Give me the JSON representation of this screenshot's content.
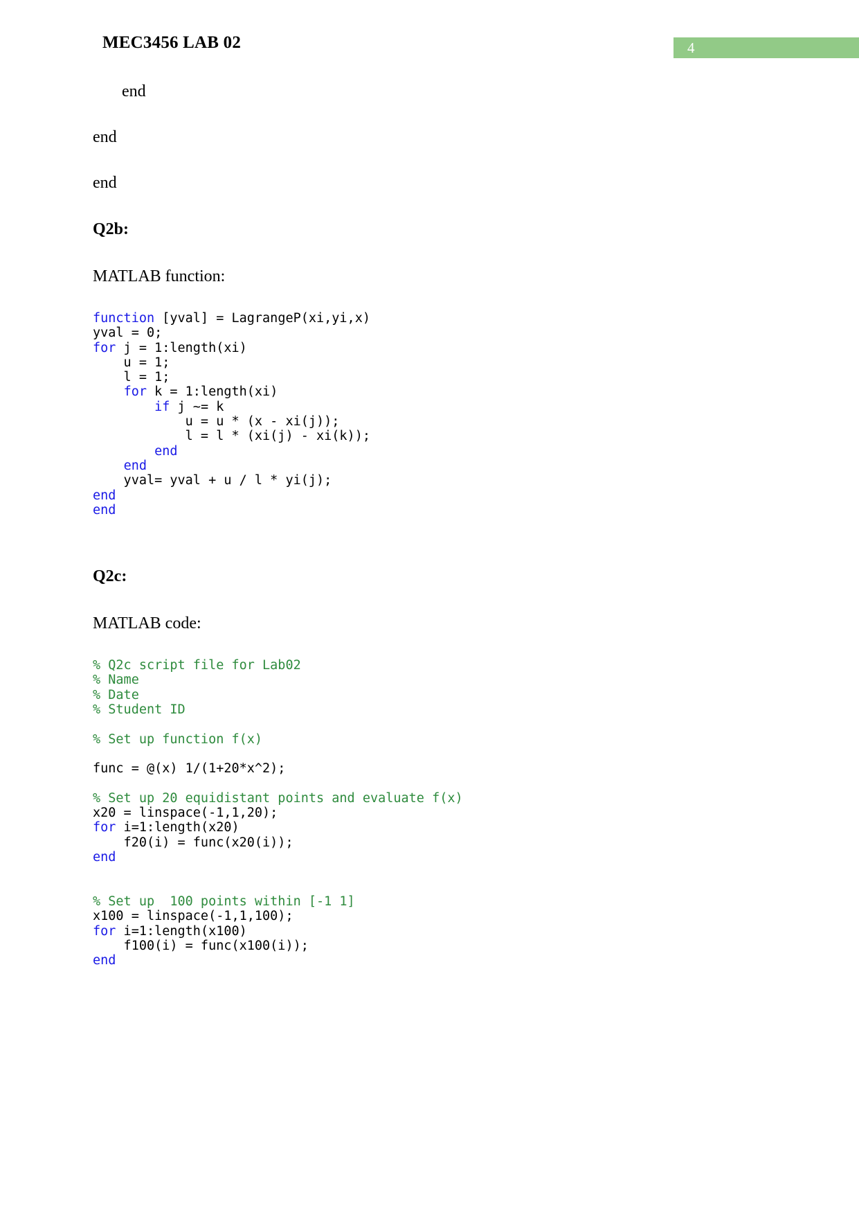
{
  "header": {
    "title": "MEC3456 LAB 02",
    "page_number": "4",
    "badge_color": "#92ca87"
  },
  "content": {
    "end_indented": "   end",
    "end_1": "end",
    "end_2": "end",
    "q2b_heading": "Q2b:",
    "matlab_function_label": "MATLAB function:",
    "q2c_heading": "Q2c:",
    "matlab_code_label": "MATLAB code:"
  },
  "code_function": {
    "lines": [
      [
        {
          "t": "function",
          "c": "kw"
        },
        {
          "t": " [yval] = LagrangeP(xi,yi,x)",
          "c": ""
        }
      ],
      [
        {
          "t": "yval = 0;",
          "c": ""
        }
      ],
      [
        {
          "t": "for",
          "c": "kw"
        },
        {
          "t": " j = 1:length(xi)",
          "c": ""
        }
      ],
      [
        {
          "t": "    u = 1;",
          "c": ""
        }
      ],
      [
        {
          "t": "    l = 1;",
          "c": ""
        }
      ],
      [
        {
          "t": "    ",
          "c": ""
        },
        {
          "t": "for",
          "c": "kw"
        },
        {
          "t": " k = 1:length(xi)",
          "c": ""
        }
      ],
      [
        {
          "t": "        ",
          "c": ""
        },
        {
          "t": "if",
          "c": "kw"
        },
        {
          "t": " j ~= k",
          "c": ""
        }
      ],
      [
        {
          "t": "            u = u * (x - xi(j));",
          "c": ""
        }
      ],
      [
        {
          "t": "            l = l * (xi(j) - xi(k));",
          "c": ""
        }
      ],
      [
        {
          "t": "        ",
          "c": ""
        },
        {
          "t": "end",
          "c": "kw"
        }
      ],
      [
        {
          "t": "    ",
          "c": ""
        },
        {
          "t": "end",
          "c": "kw"
        }
      ],
      [
        {
          "t": "    yval= yval + u / l * yi(j);",
          "c": ""
        }
      ],
      [
        {
          "t": "end",
          "c": "kw"
        }
      ],
      [
        {
          "t": "end",
          "c": "kw"
        }
      ]
    ]
  },
  "code_script": {
    "lines": [
      [
        {
          "t": "% Q2c script file for Lab02",
          "c": "cmt"
        }
      ],
      [
        {
          "t": "% Name",
          "c": "cmt"
        }
      ],
      [
        {
          "t": "% Date",
          "c": "cmt"
        }
      ],
      [
        {
          "t": "% Student ID",
          "c": "cmt"
        }
      ],
      [
        {
          "t": "",
          "c": ""
        }
      ],
      [
        {
          "t": "% Set up function f(x)",
          "c": "cmt"
        }
      ],
      [
        {
          "t": "",
          "c": ""
        }
      ],
      [
        {
          "t": "func = @(x) 1/(1+20*x^2);",
          "c": ""
        }
      ],
      [
        {
          "t": "",
          "c": ""
        }
      ],
      [
        {
          "t": "% Set up 20 equidistant points and evaluate f(x)",
          "c": "cmt"
        }
      ],
      [
        {
          "t": "x20 = linspace(-1,1,20);",
          "c": ""
        }
      ],
      [
        {
          "t": "for",
          "c": "kw"
        },
        {
          "t": " i=1:length(x20)",
          "c": ""
        }
      ],
      [
        {
          "t": "    f20(i) = func(x20(i));",
          "c": ""
        }
      ],
      [
        {
          "t": "end",
          "c": "kw"
        }
      ],
      [
        {
          "t": "",
          "c": ""
        }
      ],
      [
        {
          "t": "",
          "c": ""
        }
      ],
      [
        {
          "t": "% Set up  100 points within [-1 1]",
          "c": "cmt"
        }
      ],
      [
        {
          "t": "x100 = linspace(-1,1,100);",
          "c": ""
        }
      ],
      [
        {
          "t": "for",
          "c": "kw"
        },
        {
          "t": " i=1:length(x100)",
          "c": ""
        }
      ],
      [
        {
          "t": "    f100(i) = func(x100(i));",
          "c": ""
        }
      ],
      [
        {
          "t": "end",
          "c": "kw"
        }
      ]
    ]
  }
}
